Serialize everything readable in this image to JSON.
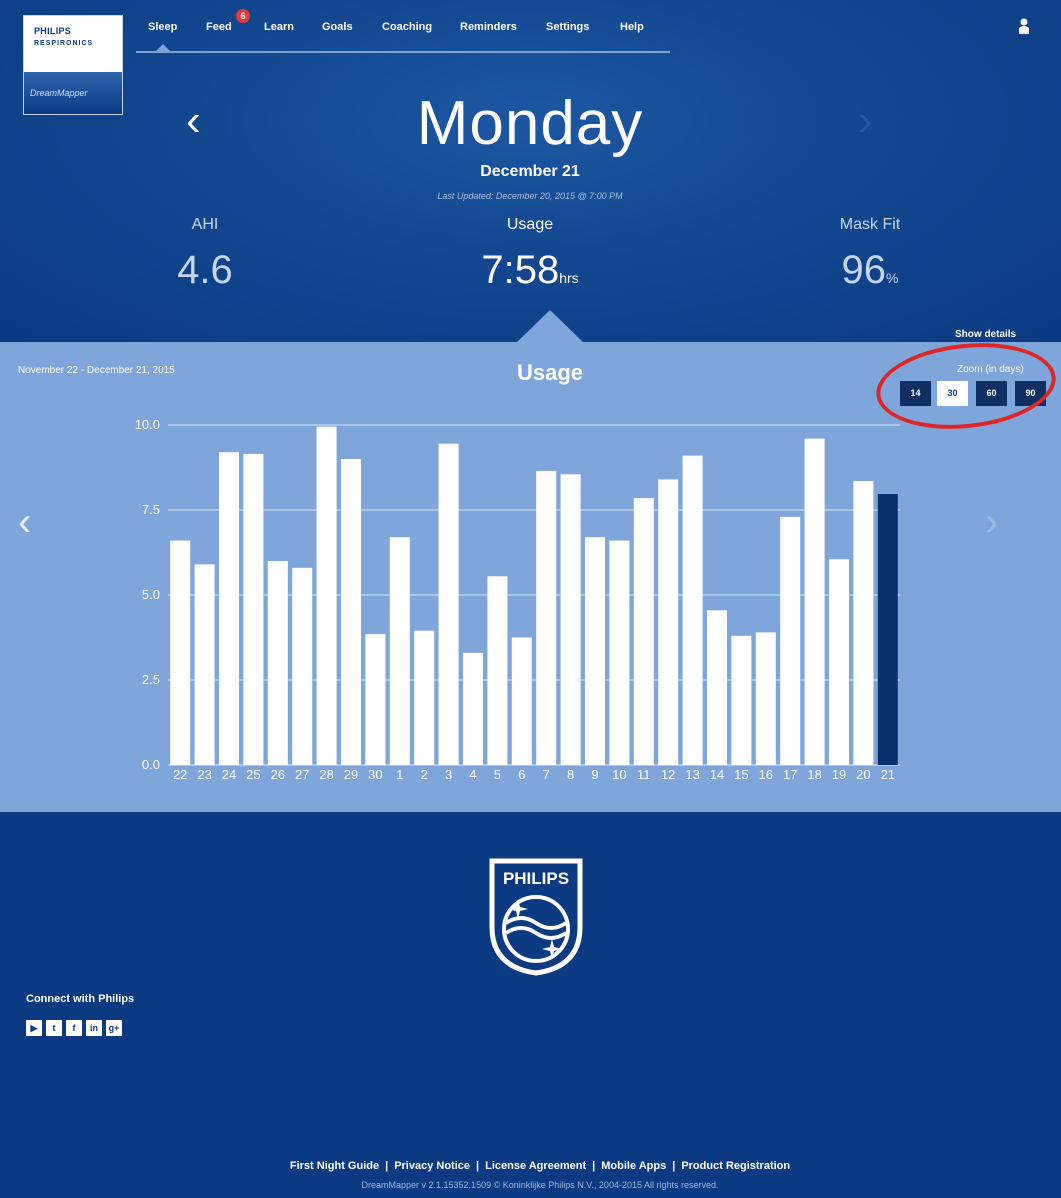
{
  "logo": {
    "brand": "PHILIPS",
    "sub": "RESPIRONICS",
    "app": "DreamMapper"
  },
  "nav": {
    "items": [
      "Sleep",
      "Feed",
      "Learn",
      "Goals",
      "Coaching",
      "Reminders",
      "Settings",
      "Help"
    ],
    "active": "Sleep",
    "feed_badge": "6",
    "user_icon": "user-icon"
  },
  "day": {
    "title": "Monday",
    "date": "December 21",
    "updated": "Last Updated: December 20, 2015 @ 7:00 PM",
    "prev": "‹",
    "next": "›"
  },
  "metrics": {
    "ahi": {
      "label": "AHI",
      "value": "4.6",
      "unit": ""
    },
    "usage": {
      "label": "Usage",
      "value": "7:58",
      "unit": "hrs"
    },
    "mask_fit": {
      "label": "Mask Fit",
      "value": "96",
      "unit": "%"
    }
  },
  "panel": {
    "show_details": "Show details",
    "range": "November 22 - December 21, 2015",
    "title": "Usage",
    "zoom_label": "Zoom (in days)",
    "zoom_options": [
      "14",
      "30",
      "60",
      "90"
    ],
    "zoom_selected": "30",
    "prev": "‹",
    "next": "›"
  },
  "chart_data": {
    "type": "bar",
    "title": "Usage",
    "categories": [
      "22",
      "23",
      "24",
      "25",
      "26",
      "27",
      "28",
      "29",
      "30",
      "1",
      "2",
      "3",
      "4",
      "5",
      "6",
      "7",
      "8",
      "9",
      "10",
      "11",
      "12",
      "13",
      "14",
      "15",
      "16",
      "17",
      "18",
      "19",
      "20",
      "21"
    ],
    "values": [
      6.6,
      5.9,
      9.2,
      9.15,
      6.0,
      5.8,
      9.95,
      9.0,
      3.85,
      6.7,
      3.95,
      9.45,
      3.3,
      5.55,
      3.75,
      8.65,
      8.55,
      6.7,
      6.6,
      7.85,
      8.4,
      9.1,
      4.55,
      3.8,
      3.9,
      7.3,
      9.6,
      6.05,
      8.35,
      7.97
    ],
    "highlight_index": 29,
    "yticks": [
      "0.0",
      "2.5",
      "5.0",
      "7.5",
      "10.0"
    ],
    "ylim": [
      0,
      10
    ],
    "grid": true,
    "colors": {
      "bar": "#ffffff",
      "highlight": "#0b2f6e",
      "grid": "#dbe6f5"
    }
  },
  "footer": {
    "connect": "Connect with Philips",
    "social": [
      "youtube-icon",
      "twitter-icon",
      "facebook-icon",
      "linkedin-icon",
      "googleplus-icon"
    ],
    "shield_brand": "PHILIPS",
    "links": [
      "First Night Guide",
      "Privacy Notice",
      "License Agreement",
      "Mobile Apps",
      "Product Registration"
    ],
    "separator": "|",
    "copyright": "DreamMapper v 2.1.15352.1509 © Koninklijke Philips N.V., 2004-2015 All rights reserved."
  }
}
